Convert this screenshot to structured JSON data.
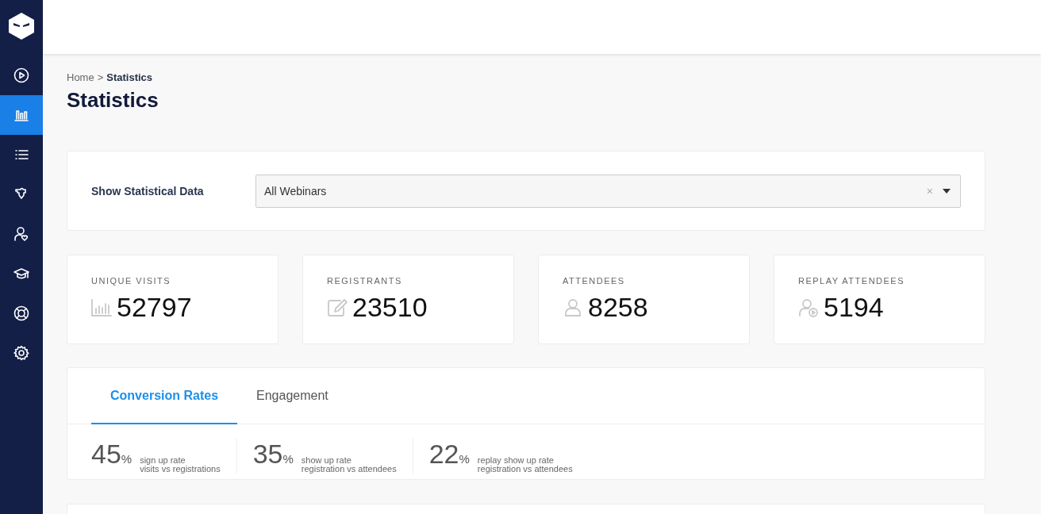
{
  "sidebar": {
    "items": [
      {
        "selected": false
      },
      {
        "selected": true
      },
      {
        "selected": false
      },
      {
        "selected": false
      },
      {
        "selected": false
      },
      {
        "selected": false
      },
      {
        "selected": false
      },
      {
        "selected": false
      }
    ]
  },
  "breadcrumb": {
    "home": "Home",
    "separator": ">",
    "current": "Statistics"
  },
  "page_title": "Statistics",
  "filter": {
    "label": "Show Statistical Data",
    "value": "All Webinars",
    "clear": "×"
  },
  "stats": [
    {
      "label": "UNIQUE VISITS",
      "value": "52797"
    },
    {
      "label": "REGISTRANTS",
      "value": "23510"
    },
    {
      "label": "ATTENDEES",
      "value": "8258"
    },
    {
      "label": "REPLAY ATTENDEES",
      "value": "5194"
    }
  ],
  "tabs": [
    {
      "label": "Conversion Rates",
      "selected": true
    },
    {
      "label": "Engagement",
      "selected": false
    }
  ],
  "rates": [
    {
      "value": "45",
      "unit": "%",
      "title": "sign up rate",
      "subtitle": "visits vs registrations"
    },
    {
      "value": "35",
      "unit": "%",
      "title": "show up rate",
      "subtitle": "registration vs attendees"
    },
    {
      "value": "22",
      "unit": "%",
      "title": "replay show up rate",
      "subtitle": "registration vs attendees"
    }
  ]
}
